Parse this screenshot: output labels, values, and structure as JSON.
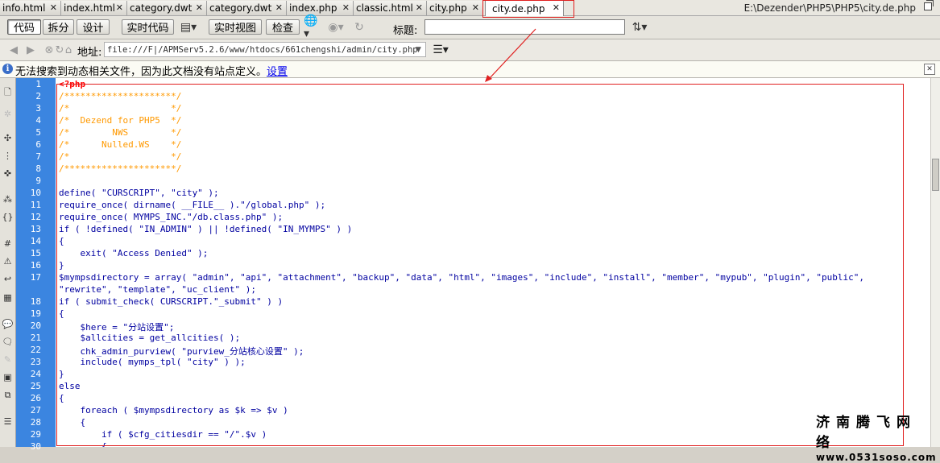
{
  "tabs": [
    {
      "label": "info.html",
      "active": false
    },
    {
      "label": "index.html",
      "active": false
    },
    {
      "label": "category.dwt",
      "active": false
    },
    {
      "label": "category.dwt",
      "active": false
    },
    {
      "label": "index.php",
      "active": false
    },
    {
      "label": "classic.html",
      "active": false
    },
    {
      "label": "city.php",
      "active": false
    },
    {
      "label": "city.de.php",
      "active": true
    }
  ],
  "file_path": "E:\\Dezender\\PHP5\\PHP5\\city.de.php",
  "toolbar": {
    "code_label": "代码",
    "split_label": "拆分",
    "design_label": "设计",
    "live_code_label": "实时代码",
    "live_view_label": "实时视图",
    "inspect_label": "检查",
    "title_label": "标题:",
    "title_value": ""
  },
  "address": {
    "label": "地址:",
    "value": "file:///F|/APMServ5.2.6/www/htdocs/661chengshi/admin/city.php"
  },
  "info_bar": {
    "message": "无法搜索到动态相关文件，因为此文档没有站点定义。",
    "link": "设置"
  },
  "code_lines": [
    {
      "num": "1",
      "text": "<?php",
      "kind": "ph"
    },
    {
      "num": "2",
      "text": "/*********************/",
      "kind": "c"
    },
    {
      "num": "3",
      "text": "/*                   */",
      "kind": "c"
    },
    {
      "num": "4",
      "text": "/*  Dezend for PHP5  */",
      "kind": "c"
    },
    {
      "num": "5",
      "text": "/*        NWS        */",
      "kind": "c"
    },
    {
      "num": "6",
      "text": "/*      Nulled.WS    */",
      "kind": "c"
    },
    {
      "num": "7",
      "text": "/*                   */",
      "kind": "c"
    },
    {
      "num": "8",
      "text": "/*********************/",
      "kind": "c"
    },
    {
      "num": "9",
      "text": "",
      "kind": "k"
    },
    {
      "num": "10",
      "text": "define( \"CURSCRIPT\", \"city\" );",
      "kind": "k"
    },
    {
      "num": "11",
      "text": "require_once( dirname( __FILE__ ).\"/global.php\" );",
      "kind": "k"
    },
    {
      "num": "12",
      "text": "require_once( MYMPS_INC.\"/db.class.php\" );",
      "kind": "k"
    },
    {
      "num": "13",
      "text": "if ( !defined( \"IN_ADMIN\" ) || !defined( \"IN_MYMPS\" ) )",
      "kind": "k"
    },
    {
      "num": "14",
      "text": "{",
      "kind": "k"
    },
    {
      "num": "15",
      "text": "    exit( \"Access Denied\" );",
      "kind": "k"
    },
    {
      "num": "16",
      "text": "}",
      "kind": "k"
    },
    {
      "num": "17",
      "text": "$mympsdirectory = array( \"admin\", \"api\", \"attachment\", \"backup\", \"data\", \"html\", \"images\", \"include\", \"install\", \"member\", \"mypub\", \"plugin\", \"public\",",
      "kind": "k"
    },
    {
      "num": "",
      "text": "\"rewrite\", \"template\", \"uc_client\" );",
      "kind": "k"
    },
    {
      "num": "18",
      "text": "if ( submit_check( CURSCRIPT.\"_submit\" ) )",
      "kind": "k"
    },
    {
      "num": "19",
      "text": "{",
      "kind": "k"
    },
    {
      "num": "20",
      "text": "    $here = \"分站设置\";",
      "kind": "k"
    },
    {
      "num": "21",
      "text": "    $allcities = get_allcities( );",
      "kind": "k"
    },
    {
      "num": "22",
      "text": "    chk_admin_purview( \"purview_分站核心设置\" );",
      "kind": "k"
    },
    {
      "num": "23",
      "text": "    include( mymps_tpl( \"city\" ) );",
      "kind": "k"
    },
    {
      "num": "24",
      "text": "}",
      "kind": "k"
    },
    {
      "num": "25",
      "text": "else",
      "kind": "k"
    },
    {
      "num": "26",
      "text": "{",
      "kind": "k"
    },
    {
      "num": "27",
      "text": "    foreach ( $mympsdirectory as $k => $v )",
      "kind": "k"
    },
    {
      "num": "28",
      "text": "    {",
      "kind": "k"
    },
    {
      "num": "29",
      "text": "        if ( $cfg_citiesdir == \"/\".$v )",
      "kind": "k"
    },
    {
      "num": "30",
      "text": "        {",
      "kind": "k"
    }
  ],
  "watermark": {
    "line1": "济南腾飞网络",
    "line2": "www.0531soso.com"
  },
  "colors": {
    "gutter": "#3b85e0",
    "comment": "#ff9900",
    "keyword": "#0000a0",
    "highlight_box": "#e02020"
  }
}
